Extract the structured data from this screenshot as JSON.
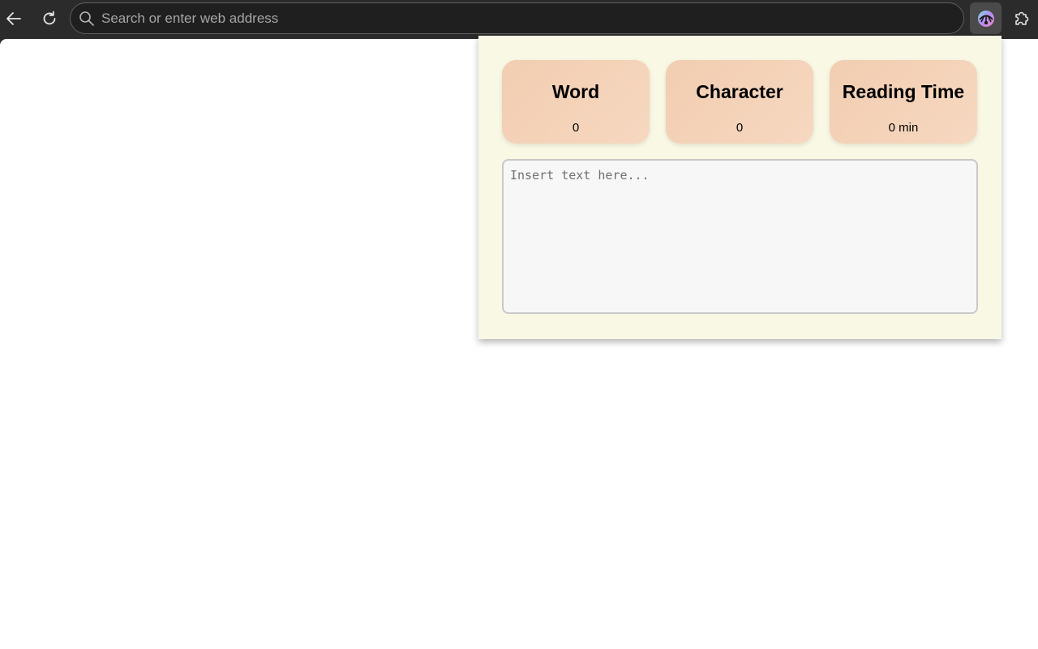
{
  "browser": {
    "address_placeholder": "Search or enter web address",
    "icons": {
      "back": "back-arrow-icon",
      "reload": "reload-icon",
      "search": "search-icon",
      "extension": "extension-app-icon",
      "extensions_menu": "puzzle-icon"
    }
  },
  "popup": {
    "cards": [
      {
        "title": "Word",
        "value": "0"
      },
      {
        "title": "Character",
        "value": "0"
      },
      {
        "title": "Reading Time",
        "value": "0 min"
      }
    ],
    "text_area_placeholder": "Insert text here...",
    "colors": {
      "background": "#f9f8e4",
      "card": "#f2cdb1"
    }
  }
}
